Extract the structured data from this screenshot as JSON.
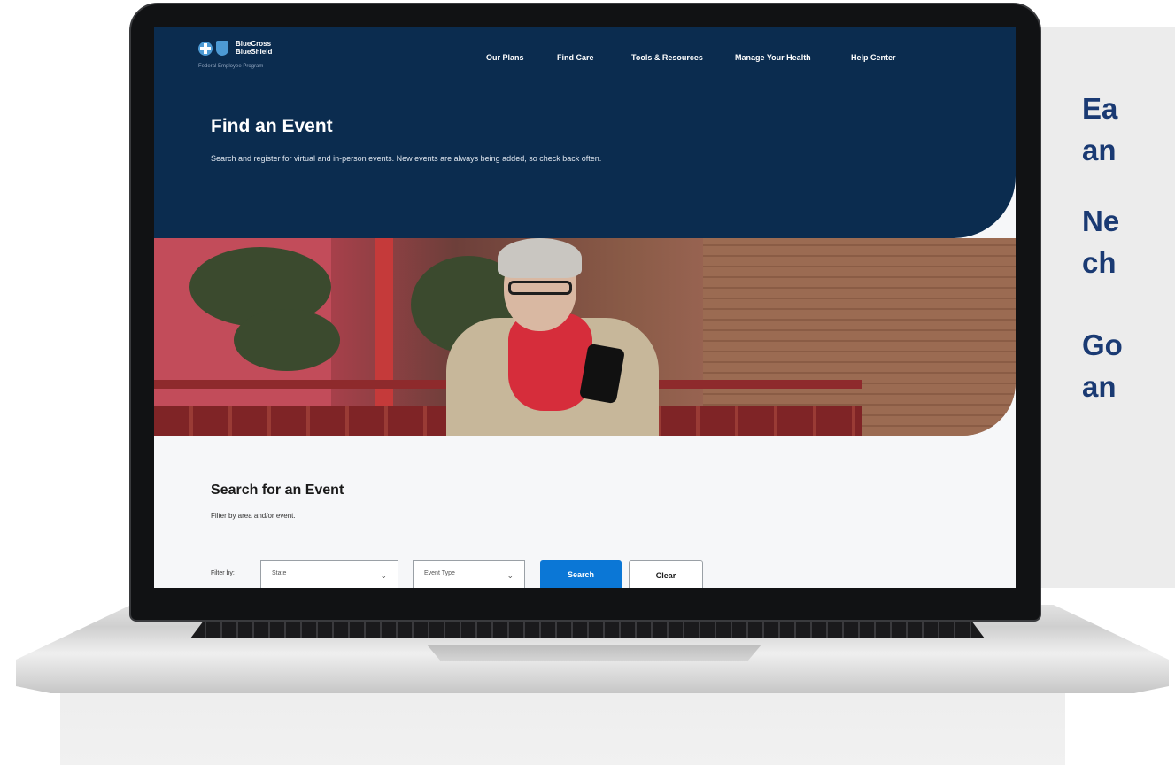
{
  "side_panel": {
    "lines": [
      "Ea",
      "an",
      "Ne",
      "ch",
      "Go",
      "an"
    ]
  },
  "site": {
    "logo": {
      "line1": "BlueCross",
      "line2": "BlueShield",
      "subtitle": "Federal Employee Program"
    },
    "nav": [
      "Our Plans",
      "Find Care",
      "Tools & Resources",
      "Manage Your Health",
      "Help Center"
    ],
    "page_title": "Find an Event",
    "page_description": "Search and register for virtual and in-person events. New events are always being added, so check back often.",
    "search": {
      "title": "Search for an Event",
      "subtitle": "Filter by area and/or event.",
      "filter_label": "Filter by:",
      "state_select": "State",
      "event_type_select": "Event Type",
      "search_button": "Search",
      "clear_button": "Clear"
    }
  },
  "colors": {
    "header_navy": "#0b2c4f",
    "side_text_blue": "#1a3a73",
    "search_button_blue": "#0b77d6"
  }
}
